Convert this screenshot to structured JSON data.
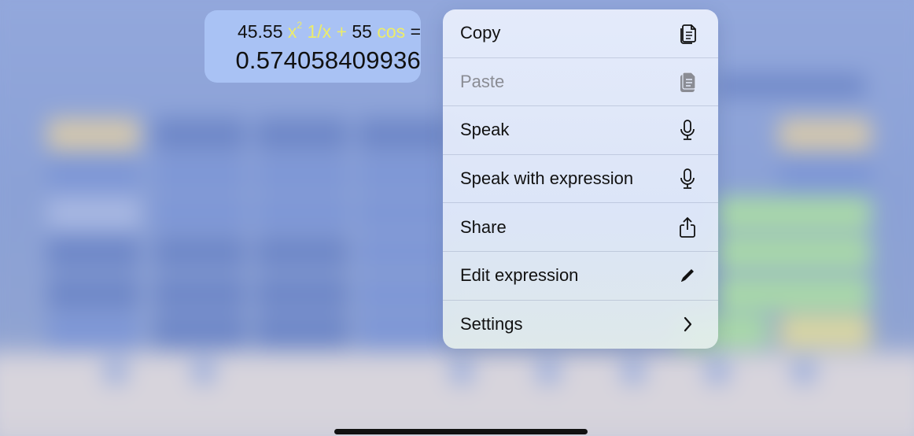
{
  "expression": {
    "number1": "45.55",
    "op_square": "x",
    "op_square_sup": "2",
    "op_reciprocal": "1/x",
    "plus": "+",
    "number2": "55",
    "op_cos": "cos",
    "equals": "=",
    "result": "0.574058409936"
  },
  "menu": {
    "items": [
      {
        "label": "Copy",
        "icon": "copy-icon",
        "enabled": true
      },
      {
        "label": "Paste",
        "icon": "paste-icon",
        "enabled": false
      },
      {
        "label": "Speak",
        "icon": "microphone-icon",
        "enabled": true
      },
      {
        "label": "Speak with expression",
        "icon": "microphone-icon",
        "enabled": true
      },
      {
        "label": "Share",
        "icon": "share-icon",
        "enabled": true
      },
      {
        "label": "Edit expression",
        "icon": "pencil-icon",
        "enabled": true
      },
      {
        "label": "Settings",
        "icon": "chevron-right-icon",
        "enabled": true
      }
    ]
  },
  "colors": {
    "bubble": "#a9c2f4",
    "operator_yellow": "#ecec6a",
    "disabled_text": "#8a8c94"
  }
}
